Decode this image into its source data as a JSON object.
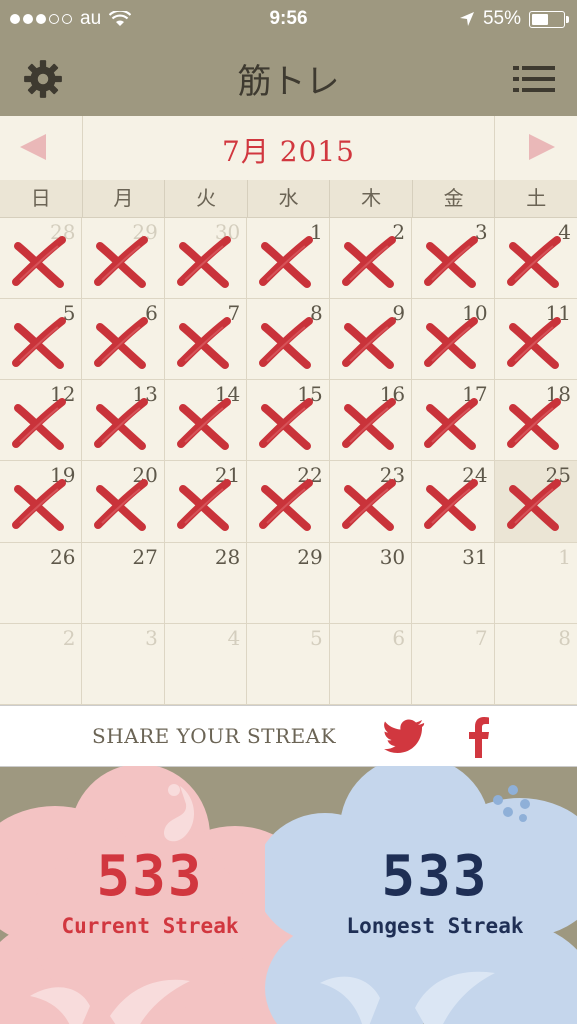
{
  "status": {
    "carrier": "au",
    "time": "9:56",
    "battery": "55%",
    "signal_bars": 3
  },
  "nav": {
    "title": "筋トレ",
    "settings_icon": "gear-icon",
    "menu_icon": "list-menu-icon"
  },
  "calendar": {
    "month_title": "7月 2015",
    "weekdays": [
      "日",
      "月",
      "火",
      "水",
      "木",
      "金",
      "土"
    ],
    "days": [
      {
        "n": "28",
        "other": true,
        "x": true
      },
      {
        "n": "29",
        "other": true,
        "x": true
      },
      {
        "n": "30",
        "other": true,
        "x": true
      },
      {
        "n": "1",
        "x": true
      },
      {
        "n": "2",
        "x": true
      },
      {
        "n": "3",
        "x": true
      },
      {
        "n": "4",
        "x": true
      },
      {
        "n": "5",
        "x": true
      },
      {
        "n": "6",
        "x": true
      },
      {
        "n": "7",
        "x": true
      },
      {
        "n": "8",
        "x": true
      },
      {
        "n": "9",
        "x": true
      },
      {
        "n": "10",
        "x": true
      },
      {
        "n": "11",
        "x": true
      },
      {
        "n": "12",
        "x": true
      },
      {
        "n": "13",
        "x": true
      },
      {
        "n": "14",
        "x": true
      },
      {
        "n": "15",
        "x": true
      },
      {
        "n": "16",
        "x": true
      },
      {
        "n": "17",
        "x": true
      },
      {
        "n": "18",
        "x": true
      },
      {
        "n": "19",
        "x": true
      },
      {
        "n": "20",
        "x": true
      },
      {
        "n": "21",
        "x": true
      },
      {
        "n": "22",
        "x": true
      },
      {
        "n": "23",
        "x": true
      },
      {
        "n": "24",
        "x": true
      },
      {
        "n": "25",
        "x": true,
        "today": true
      },
      {
        "n": "26"
      },
      {
        "n": "27"
      },
      {
        "n": "28"
      },
      {
        "n": "29"
      },
      {
        "n": "30"
      },
      {
        "n": "31"
      },
      {
        "n": "1",
        "other": true
      },
      {
        "n": "2",
        "other": true
      },
      {
        "n": "3",
        "other": true
      },
      {
        "n": "4",
        "other": true
      },
      {
        "n": "5",
        "other": true
      },
      {
        "n": "6",
        "other": true
      },
      {
        "n": "7",
        "other": true
      },
      {
        "n": "8",
        "other": true
      }
    ]
  },
  "share": {
    "label": "SHARE YOUR STREAK",
    "twitter_icon": "twitter-icon",
    "facebook_icon": "facebook-icon"
  },
  "streaks": {
    "current": {
      "value": "533",
      "label": "Current Streak",
      "color": "#d1373f"
    },
    "longest": {
      "value": "533",
      "label": "Longest Streak",
      "color": "#1f2f55"
    }
  },
  "colors": {
    "accent_red": "#d1373f",
    "nav_bg": "#9e9880",
    "calendar_bg": "#f6f2e6"
  }
}
